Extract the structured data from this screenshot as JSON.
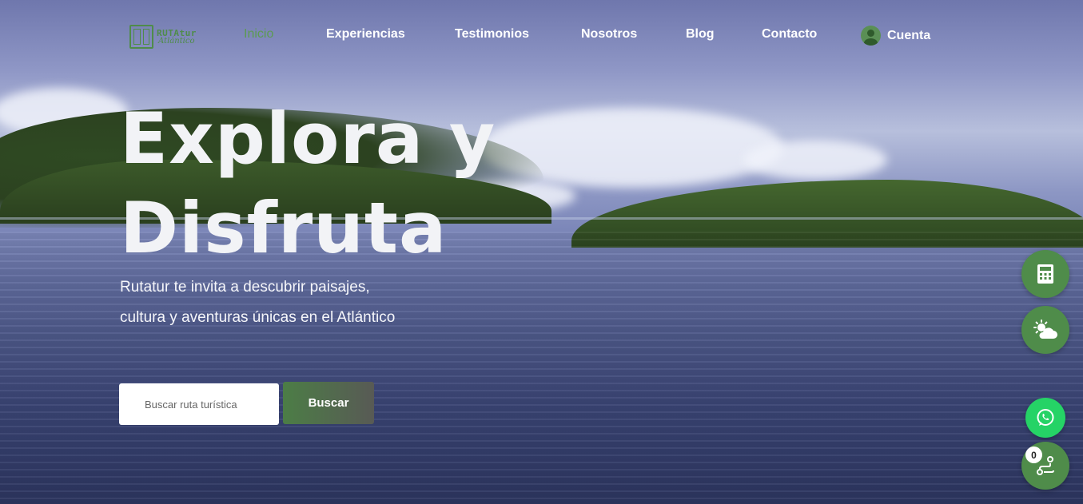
{
  "brand": {
    "logo_top": "RUTAtur",
    "logo_sub": "Atlántico",
    "color": "#4f8c4a"
  },
  "nav": {
    "items": [
      {
        "label": "Inicio",
        "active": true
      },
      {
        "label": "Experiencias",
        "active": false
      },
      {
        "label": "Testimonios",
        "active": false
      },
      {
        "label": "Nosotros",
        "active": false
      },
      {
        "label": "Blog",
        "active": false
      },
      {
        "label": "Contacto",
        "active": false
      }
    ],
    "account_label": "Cuenta",
    "account_icon": "user-circle-icon"
  },
  "hero": {
    "title_line1": "Explora y",
    "title_line2": "Disfruta",
    "subtitle_line1": "Rutatur te invita a descubrir paisajes,",
    "subtitle_line2": "cultura y aventuras únicas en el Atlántico"
  },
  "search": {
    "placeholder": "Buscar ruta turística",
    "button_label": "Buscar"
  },
  "floating": {
    "calculator_icon": "calculator-icon",
    "weather_icon": "sun-cloud-icon",
    "whatsapp_icon": "whatsapp-icon",
    "route_icon": "route-icon",
    "route_count": "0"
  }
}
